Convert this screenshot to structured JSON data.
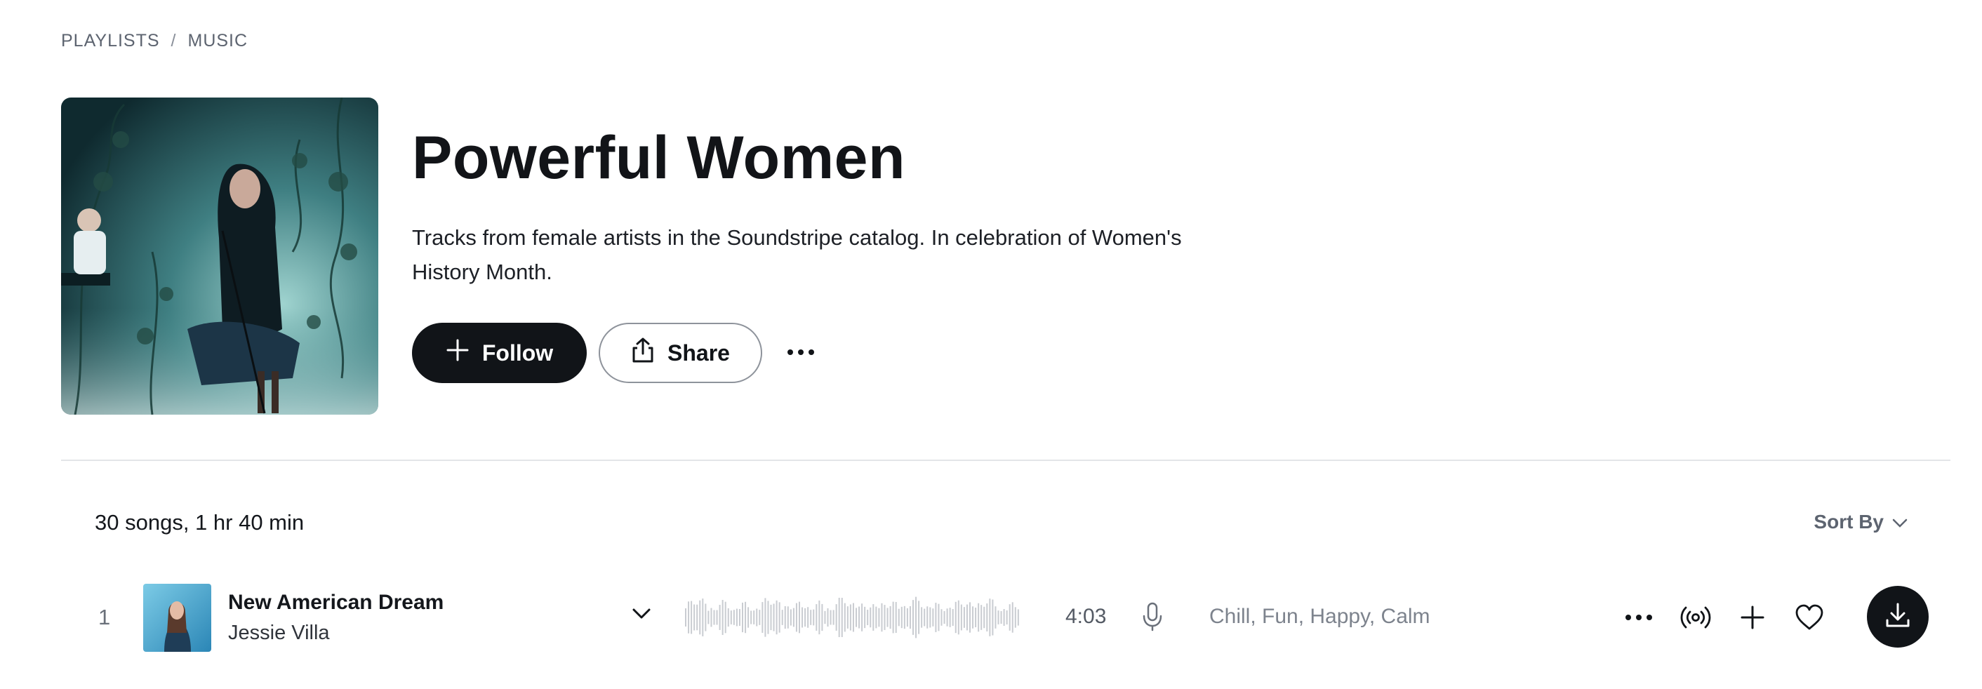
{
  "breadcrumb": {
    "items": [
      "PLAYLISTS",
      "MUSIC"
    ],
    "separator": "/"
  },
  "playlist": {
    "title": "Powerful Women",
    "description": "Tracks from female artists in the Soundstripe catalog. In celebration of Women's History Month.",
    "cover_icon": "playlist-cover-image"
  },
  "actions": {
    "follow_label": "Follow",
    "share_label": "Share",
    "more_icon": "ellipsis-icon"
  },
  "summary": {
    "count_text": "30 songs, 1 hr 40 min",
    "sort_label": "Sort By"
  },
  "tracks": [
    {
      "index": "1",
      "title": "New American Dream",
      "artist": "Jessie Villa",
      "duration": "4:03",
      "tags": "Chill, Fun, Happy, Calm"
    }
  ],
  "colors": {
    "primary": "#111418",
    "muted": "#5d6470",
    "divider": "#e3e5e8",
    "waveform": "#c9ccd1"
  }
}
